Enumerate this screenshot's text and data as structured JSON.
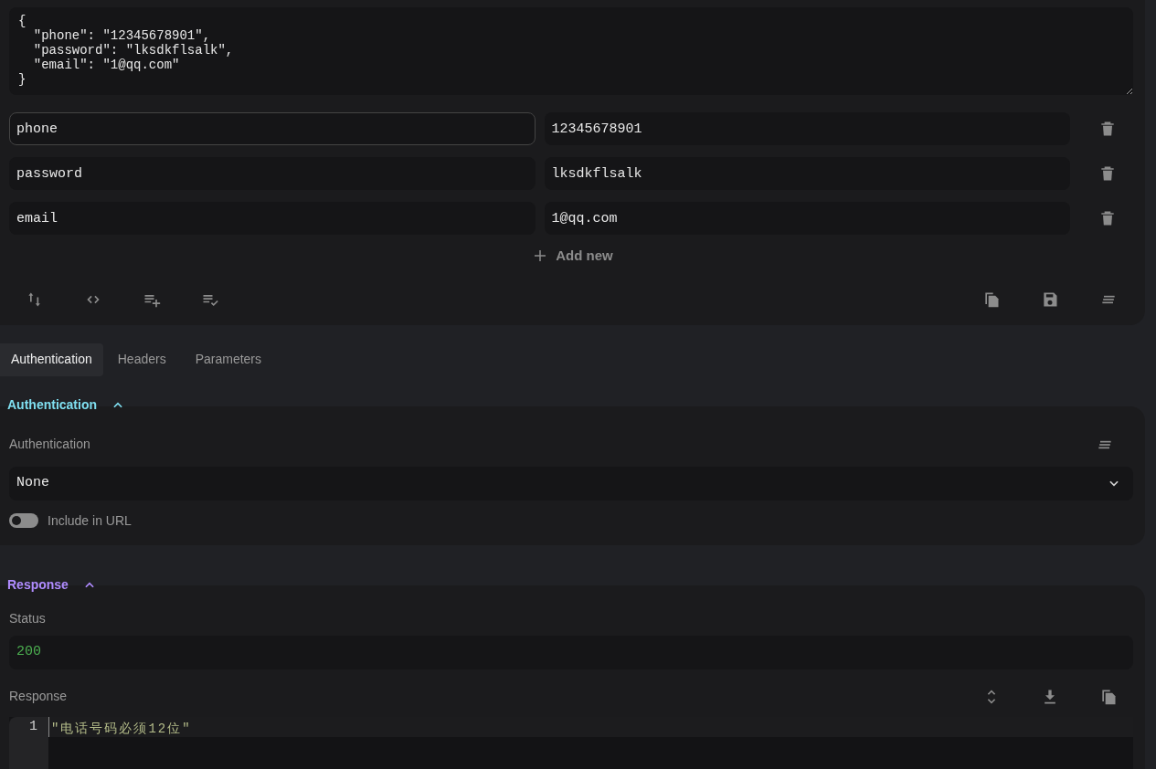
{
  "body": {
    "raw": "{\n  \"phone\": \"12345678901\",\n  \"password\": \"lksdkflsalk\",\n  \"email\": \"1@qq.com\"\n}",
    "rows": [
      {
        "key": "phone",
        "value": "12345678901",
        "focused": true
      },
      {
        "key": "password",
        "value": "lksdkflsalk",
        "focused": false
      },
      {
        "key": "email",
        "value": "1@qq.com",
        "focused": false
      }
    ],
    "add_label": "Add new"
  },
  "tabs": [
    {
      "label": "Authentication",
      "selected": true
    },
    {
      "label": "Headers",
      "selected": false
    },
    {
      "label": "Parameters",
      "selected": false
    }
  ],
  "auth": {
    "title": "Authentication",
    "expanded": true,
    "label": "Authentication",
    "value": "None",
    "include_in_url": {
      "label": "Include in URL",
      "on": false
    }
  },
  "response": {
    "title": "Response",
    "expanded": true,
    "status_label": "Status",
    "status": "200",
    "response_label": "Response",
    "lines": [
      {
        "number": "1",
        "text": "\"电话号码必须12位\""
      }
    ]
  }
}
